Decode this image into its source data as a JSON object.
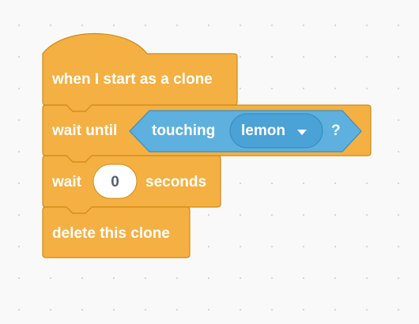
{
  "colors": {
    "control_fill": "#f4b042",
    "control_stroke": "#cf8b17",
    "sensing_fill": "#5eb1de",
    "sensing_stroke": "#3a8ec0",
    "menu_fill": "#4aa2d6",
    "input_fill": "#ffffff",
    "input_text": "#575e75",
    "label_text": "#ffffff"
  },
  "script": {
    "hat": {
      "label": "when I start as a clone"
    },
    "wait_until": {
      "label": "wait until",
      "condition": {
        "label": "touching",
        "menu_value": "lemon",
        "menu_icon": "triangle-down-icon",
        "suffix": "?"
      }
    },
    "wait": {
      "label": "wait",
      "input_value": "0",
      "unit": "seconds"
    },
    "delete": {
      "label": "delete this clone"
    }
  }
}
